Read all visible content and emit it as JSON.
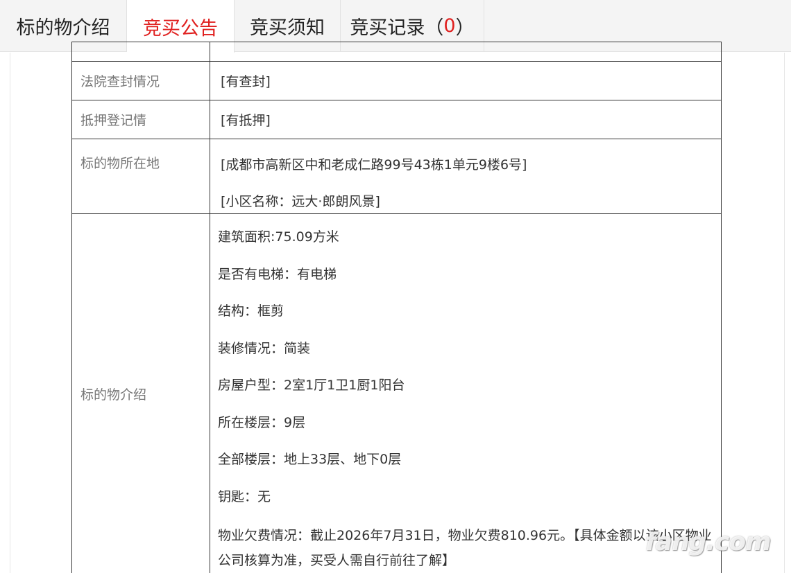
{
  "tabs": [
    {
      "label": "标的物介绍"
    },
    {
      "label": "竞买公告"
    },
    {
      "label": "竞买须知"
    },
    {
      "label": "竞买记录（",
      "count": "0",
      "suffix": "）"
    }
  ],
  "colors": {
    "accent": "#e0201f",
    "tab_bg": "#f4f4f4",
    "label_text": "#777777"
  },
  "table": {
    "court": {
      "label": "法院查封情况",
      "value": "[有查封]"
    },
    "mortgage": {
      "label": "抵押登记情",
      "value": "[有抵押]"
    },
    "location": {
      "label": "标的物所在地",
      "address": "[成都市高新区中和老成仁路99号43栋1单元9楼6号]",
      "community": "[小区名称：远大·郎朗风景]"
    },
    "intro": {
      "label": "标的物介绍",
      "lines": [
        "建筑面积:75.09方米",
        "是否有电梯：有电梯",
        "结构：框剪",
        "装修情况：简装",
        "房屋户型：2室1厅1卫1厨1阳台",
        "所在楼层：9层",
        "全部楼层：地上33层、地下0层",
        "钥匙：无",
        "物业欠费情况：截止2026年7月31日，物业欠费810.96元。【具体金额以该小区物业公司核算为准，买受人需自行前往了解】"
      ]
    }
  },
  "watermark": "fang.com"
}
